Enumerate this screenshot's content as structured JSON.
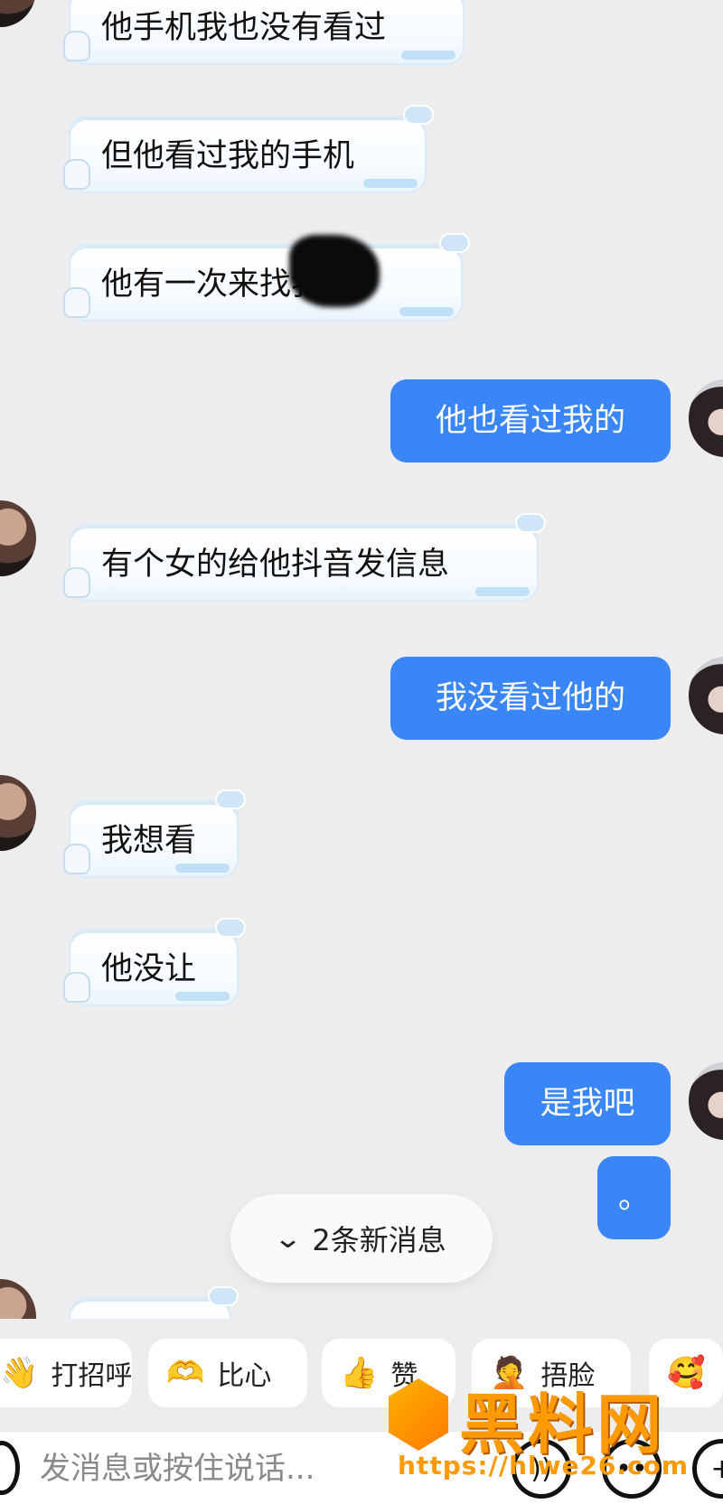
{
  "messages": [
    {
      "side": "in",
      "text": "他手机我也没有看过",
      "avatar": false
    },
    {
      "side": "in",
      "text": "但他看过我的手机",
      "avatar": false
    },
    {
      "side": "in",
      "text": "他有一次来找我",
      "avatar": false,
      "redacted": true
    },
    {
      "side": "out",
      "text": "他也看过我的",
      "avatar": true
    },
    {
      "side": "in",
      "text": "有个女的给他抖音发信息",
      "avatar": true
    },
    {
      "side": "out",
      "text": "我没看过他的",
      "avatar": true
    },
    {
      "side": "in",
      "text": "我想看",
      "avatar": true
    },
    {
      "side": "in",
      "text": "他没让",
      "avatar": false
    },
    {
      "side": "out",
      "text": "是我吧",
      "avatar": true
    },
    {
      "side": "out",
      "text": "。",
      "avatar": false
    }
  ],
  "new_messages": {
    "label": "2条新消息",
    "icon": "chevron-double-down-icon"
  },
  "quick_replies": [
    {
      "label": "打招呼",
      "icon": "wave-icon",
      "emoji": "👋"
    },
    {
      "label": "比心",
      "icon": "heart-hands-icon",
      "emoji": "🫶"
    },
    {
      "label": "赞",
      "icon": "thumbs-up-icon",
      "emoji": "👍"
    },
    {
      "label": "捂脸",
      "icon": "facepalm-icon",
      "emoji": "🤦"
    },
    {
      "label": "",
      "icon": "hug-icon",
      "emoji": "🥰"
    }
  ],
  "input": {
    "placeholder": "发消息或按住说话..."
  },
  "watermark": {
    "title": "黑料网",
    "url": "https://hlwe26.com"
  },
  "colors": {
    "outgoing_bubble": "#3a86f6",
    "background": "#ededf0",
    "watermark": "#ff9a00"
  }
}
